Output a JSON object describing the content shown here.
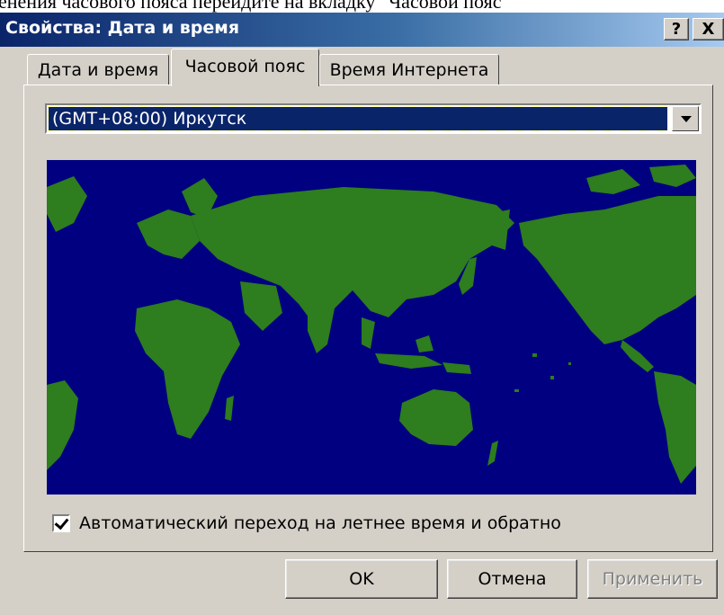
{
  "document_fragment": "енения часового пояса перейдите на вкладку \"Часовой пояс\"",
  "window": {
    "title": "Свойства: Дата и время",
    "help_label": "?",
    "close_label": "X"
  },
  "tabs": [
    {
      "label": "Дата и время",
      "active": false
    },
    {
      "label": "Часовой пояс",
      "active": true
    },
    {
      "label": "Время Интернета",
      "active": false
    }
  ],
  "timezone": {
    "selected": "(GMT+08:00) Иркутск"
  },
  "map": {
    "ocean_color": "#000080",
    "land_color": "#2e7d1e"
  },
  "dst_checkbox": {
    "label": "Автоматический переход на летнее время и обратно",
    "checked": true
  },
  "buttons": {
    "ok": "OK",
    "cancel": "Отмена",
    "apply": "Применить"
  }
}
